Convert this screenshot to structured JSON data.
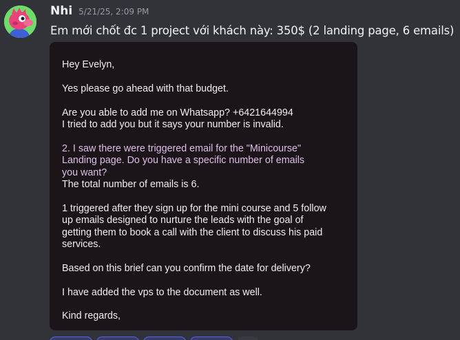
{
  "message": {
    "author": "Nhi",
    "timestamp": "5/21/25, 2:09 PM",
    "text": "Em mới chốt đc 1 project với khách này: 350$ (2 landing page, 6 emails)"
  },
  "attachment": {
    "greeting": "Hey Evelyn,",
    "line1": "Yes please go ahead with that budget.",
    "whatsapp_q": "Are you able to add me on Whatsapp? +6421644994",
    "whatsapp_note": "I tried to add you but it says your number is invalid.",
    "quoted_1": "2. I saw there were triggered email for the \"Minicourse\"",
    "quoted_2": "Landing page. Do you have a specific number of emails",
    "quoted_3": "you want?",
    "answer": "The total number of emails is 6.",
    "detail_1": "1 triggered after they sign up for the mini course and 5 follow",
    "detail_2": "up emails designed to nurture the leads with the goal of",
    "detail_3": "getting them to book a call with the client to discuss his paid",
    "detail_4": "services.",
    "delivery_q": "Based on this brief can you confirm the date for delivery?",
    "vps_note": "I have added the vps to the document as well.",
    "closing": "Kind regards,"
  },
  "colors": {
    "background": "#323339",
    "attachment_bg": "#1b1418",
    "quoted_text": "#dcbfe8",
    "avatar_bg": "#6fdc6a",
    "reaction_accent": "#5865f2"
  }
}
